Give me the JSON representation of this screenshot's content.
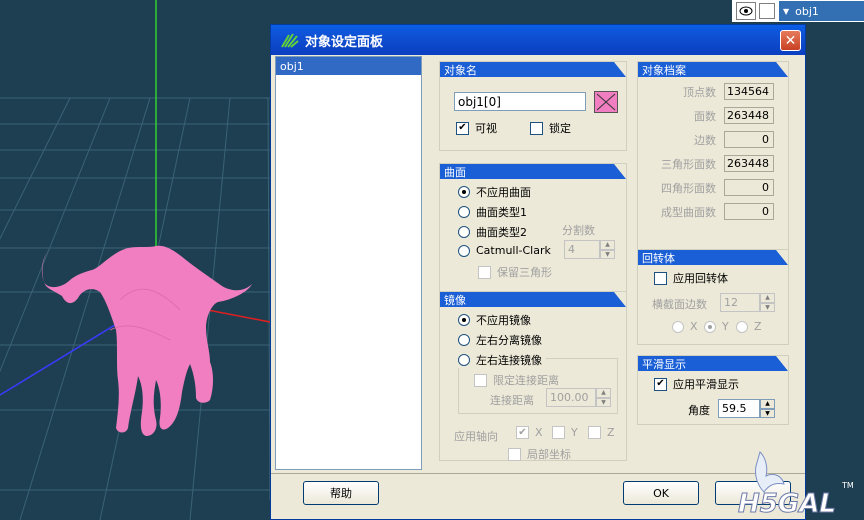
{
  "layer_panel": {
    "layer_name": "obj1"
  },
  "dialog": {
    "title": "对象设定面板",
    "close_glyph": "✕",
    "object_list": [
      "obj1"
    ],
    "object_name": {
      "header": "对象名",
      "name_value": "obj1[0]",
      "visible_label": "可视",
      "visible_checked": true,
      "lock_label": "锁定",
      "lock_checked": false
    },
    "surface": {
      "header": "曲面",
      "options": [
        "不应用曲面",
        "曲面类型1",
        "曲面类型2",
        "Catmull-Clark"
      ],
      "selected_index": 0,
      "division_label": "分割数",
      "division_value": "4",
      "keep_triangles_label": "保留三角形"
    },
    "mirror": {
      "header": "镜像",
      "options": [
        "不应用镜像",
        "左右分离镜像",
        "左右连接镜像"
      ],
      "selected_index": 0,
      "limit_distance_label": "限定连接距离",
      "distance_label": "连接距离",
      "distance_value": "100.00",
      "axis_label": "应用轴向",
      "axis_x": "X",
      "axis_y": "Y",
      "axis_z": "Z",
      "local_coords_label": "局部坐标"
    },
    "object_stats": {
      "header": "对象档案",
      "rows": [
        {
          "label": "顶点数",
          "value": "134564"
        },
        {
          "label": "面数",
          "value": "263448"
        },
        {
          "label": "边数",
          "value": "0"
        },
        {
          "label": "三角形面数",
          "value": "263448"
        },
        {
          "label": "四角形面数",
          "value": "0"
        },
        {
          "label": "成型曲面数",
          "value": "0"
        }
      ]
    },
    "lathe": {
      "header": "回转体",
      "apply_label": "应用回转体",
      "segments_label": "横截面边数",
      "segments_value": "12",
      "axis_x": "X",
      "axis_y": "Y",
      "axis_z": "Z"
    },
    "smooth": {
      "header": "平滑显示",
      "apply_label": "应用平滑显示",
      "apply_checked": true,
      "angle_label": "角度",
      "angle_value": "59.5"
    },
    "buttons": {
      "help": "帮助",
      "ok": "OK"
    }
  },
  "colors": {
    "viewport_bg": "#1e3f52",
    "model": "#f07ec0",
    "title_blue": "#0a5ee6",
    "header_blue": "#1a5fd6"
  }
}
